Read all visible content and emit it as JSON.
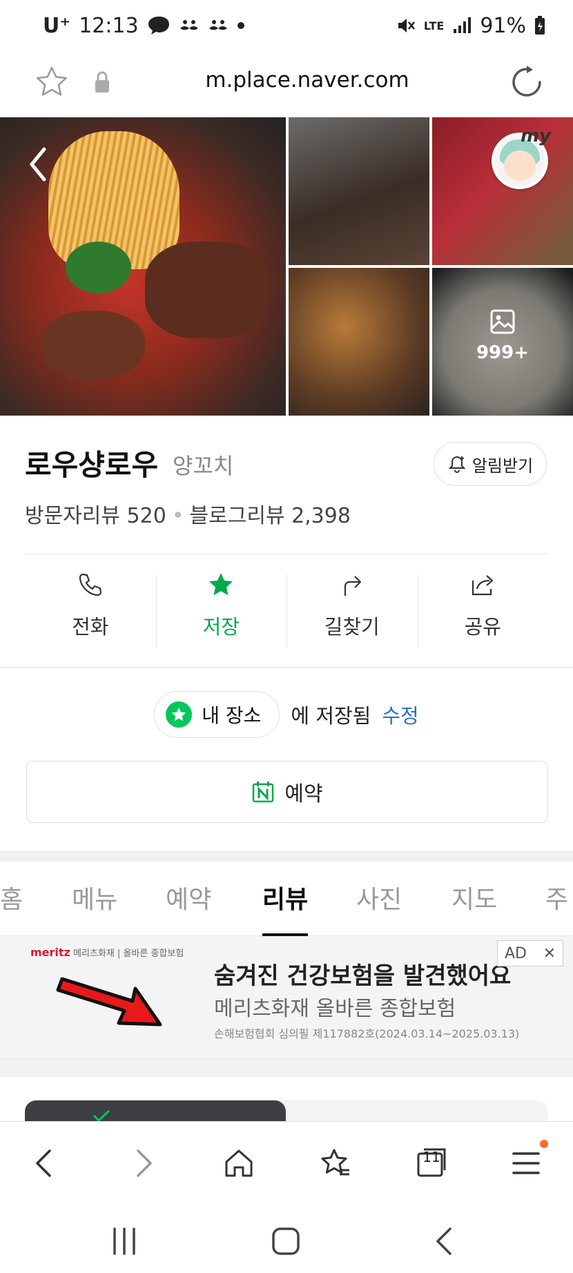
{
  "status_bar": {
    "carrier": "U⁺",
    "time": "12:13",
    "network": "LTE",
    "battery": "91%"
  },
  "browser": {
    "url": "m.place.naver.com"
  },
  "gallery": {
    "more_count": "999+",
    "avatar_badge": "my"
  },
  "place": {
    "name": "로우샹로우",
    "category": "양꼬치",
    "notify_label": "알림받기",
    "visitor_reviews_label": "방문자리뷰",
    "visitor_reviews_count": "520",
    "blog_reviews_label": "블로그리뷰",
    "blog_reviews_count": "2,398"
  },
  "actions": [
    {
      "label": "전화",
      "icon": "phone-icon"
    },
    {
      "label": "저장",
      "icon": "star-icon"
    },
    {
      "label": "길찾기",
      "icon": "directions-icon"
    },
    {
      "label": "공유",
      "icon": "share-icon"
    }
  ],
  "saved": {
    "pill_label": "내 장소",
    "suffix": "에 저장됨",
    "edit_label": "수정"
  },
  "reserve": {
    "label": "예약"
  },
  "tabs": [
    {
      "label": "홈"
    },
    {
      "label": "메뉴"
    },
    {
      "label": "예약"
    },
    {
      "label": "리뷰",
      "active": true
    },
    {
      "label": "사진"
    },
    {
      "label": "지도"
    },
    {
      "label": "주"
    }
  ],
  "ad": {
    "brand": "meritz",
    "brand_sub": "메리츠화재 | 올바른 종합보험",
    "title": "숨겨진 건강보험을 발견했어요",
    "subtitle": "메리츠화재 올바른 종합보험",
    "fine_print": "손해보험협회 심의필 제117882호(2024.03.14~2025.03.13)",
    "tag": "AD",
    "close": "✕"
  },
  "bottom_nav": {
    "tabs_count": "11"
  },
  "colors": {
    "naver_green": "#03c75a",
    "link_blue": "#2473c8",
    "notification_dot": "#ff6a2a"
  }
}
